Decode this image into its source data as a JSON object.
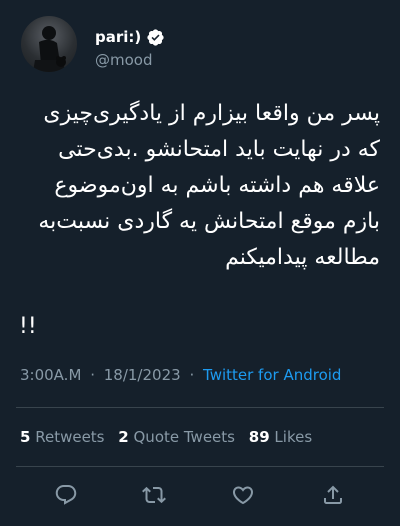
{
  "author": {
    "display_name": "pari:)",
    "handle": "@mood",
    "verified": true
  },
  "tweet": {
    "lines": [
      "پسر من واقعا بیزارم از یادگیری‌چیزی",
      "که در نهایت باید امتحانشو .بدی‌حتی",
      "علاقه هم داشته باشم به اون‌موضوع",
      "بازم موقع امتحانش یه گاردی نسبت‌به",
      "مطالعه پیدامیکنم"
    ],
    "trailing": "!!"
  },
  "meta": {
    "time": "3:00A.M",
    "separator": "·",
    "date": "18/1/2023",
    "source": "Twitter for Android"
  },
  "stats": {
    "retweets_count": "5",
    "retweets_label": "Retweets",
    "quotes_count": "2",
    "quotes_label": "Quote Tweets",
    "likes_count": "89",
    "likes_label": "Likes"
  },
  "actions": {
    "reply_icon": "reply-icon",
    "retweet_icon": "retweet-icon",
    "like_icon": "heart-icon",
    "share_icon": "share-icon"
  },
  "colors": {
    "background": "#15202b",
    "text": "#ffffff",
    "secondary": "#8899a6",
    "link": "#1d9bf0",
    "divider": "#38444d"
  }
}
